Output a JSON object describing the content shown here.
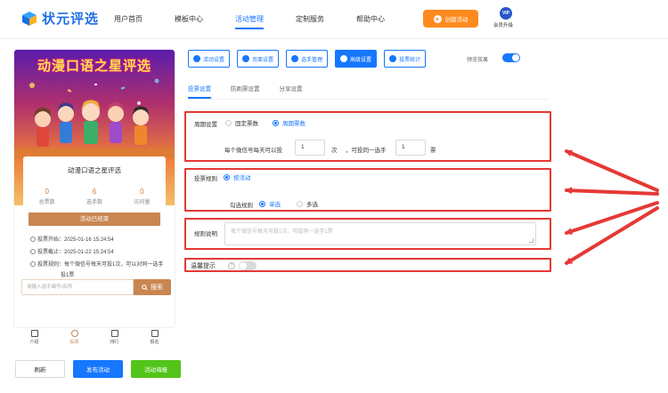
{
  "app": {
    "logo_text": "状元评选"
  },
  "nav": {
    "items": [
      "用户首页",
      "模板中心",
      "活动管理",
      "定制服务",
      "帮助中心"
    ],
    "active_index": 2,
    "create_label": "创建活动",
    "vip_badge": "VIP",
    "vip_label": "会员升级"
  },
  "phone": {
    "banner_title": "动漫口语之星评选",
    "card_title": "动漫口语之星评选",
    "stats": [
      {
        "value": "0",
        "label": "总票数"
      },
      {
        "value": "6",
        "label": "选手数"
      },
      {
        "value": "0",
        "label": "访问量"
      }
    ],
    "ended_label": "活动已结束",
    "vote_start": "投票开始：2025-01-16 15:24:54",
    "vote_end": "投票截止：2025-01-22 15:24:54",
    "vote_rule_line1": "投票规则：每个微信号每天可投1次，可以对同一选手",
    "vote_rule_line2": "投1票",
    "search_placeholder": "请输入选手编号/名称",
    "search_button": "搜索",
    "tabbar": [
      "介绍",
      "投票",
      "排行",
      "报名"
    ],
    "tabbar_active": 1
  },
  "bottom_buttons": {
    "refresh": "刷新",
    "publish": "发布活动",
    "poster": "活动海报"
  },
  "toolbar": {
    "buttons": [
      "活动设置",
      "页面设置",
      "选手管理",
      "高级设置",
      "投票统计"
    ],
    "active_index": 3,
    "preview_label": "预览效果",
    "preview_on": true
  },
  "subtabs": {
    "items": [
      "投票设置",
      "防刷票设置",
      "分享设置"
    ],
    "active_index": 0
  },
  "form": {
    "period_label": "周期设置",
    "period_options": [
      "固定票数",
      "周期票数"
    ],
    "period_selected": 1,
    "per_day_prefix": "每个微信号每天可以投",
    "per_day_value": "1",
    "per_day_unit": "次",
    "same_player_prefix": "，可投同一选手",
    "same_player_value": "1",
    "same_player_unit": "票",
    "vote_rule_label": "投票规则",
    "vote_rule_option": "按活动",
    "check_rule_label": "勾选规则",
    "check_rule_options": [
      "单选",
      "多选"
    ],
    "check_rule_selected": 0,
    "rule_desc_label": "规则说明",
    "rule_desc_placeholder": "每个微信号每天可投1次，可投同一选手1票",
    "warm_tip_label": "温馨提示",
    "help_glyph": "?",
    "warm_tip_on": false
  },
  "colors": {
    "primary": "#1677ff",
    "orange": "#ff8a1f",
    "accent_brown": "#c98651",
    "annotation_red": "#e53935",
    "success": "#52c41a"
  }
}
